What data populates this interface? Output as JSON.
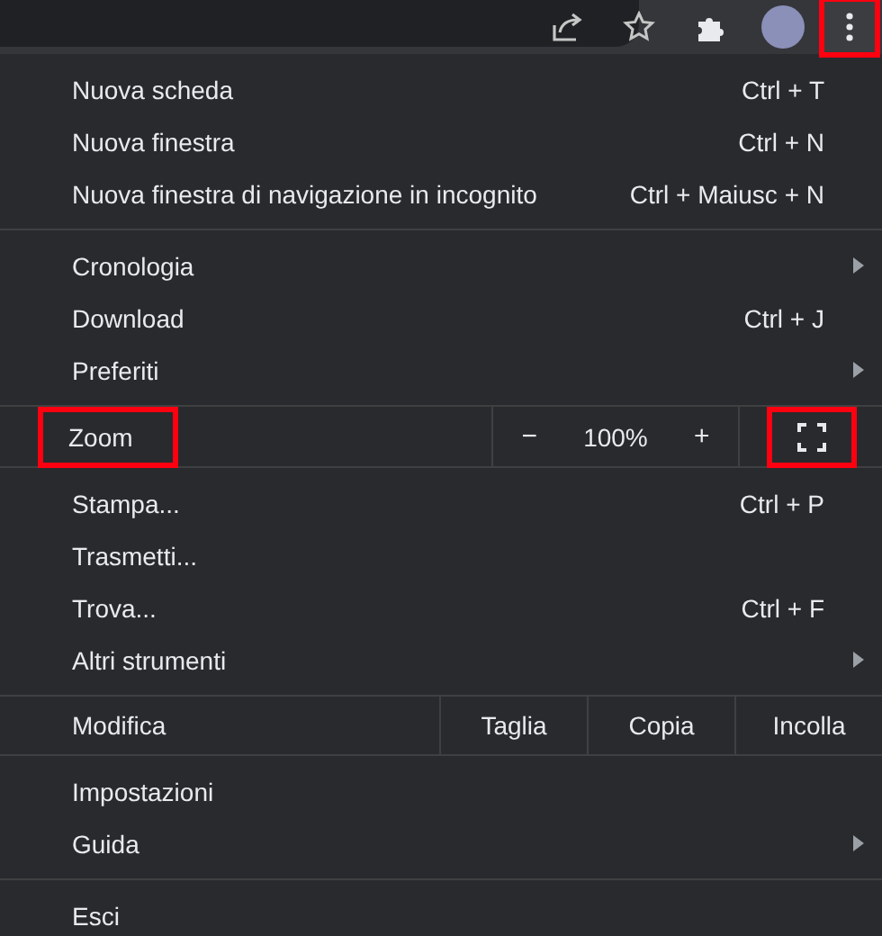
{
  "toolbar": {
    "buttons": [
      {
        "kind": "share"
      },
      {
        "kind": "star"
      },
      {
        "kind": "extensions"
      },
      {
        "kind": "avatar"
      },
      {
        "kind": "menu",
        "highlighted": true
      }
    ]
  },
  "menu": {
    "sections": [
      [
        {
          "kind": "item",
          "label": "Nuova scheda",
          "shortcut": "Ctrl + T",
          "has_submenu": false
        },
        {
          "kind": "item",
          "label": "Nuova finestra",
          "shortcut": "Ctrl + N",
          "has_submenu": false
        },
        {
          "kind": "item",
          "label": "Nuova finestra di navigazione in incognito",
          "shortcut": "Ctrl + Maiusc + N",
          "has_submenu": false
        }
      ],
      [
        {
          "kind": "item",
          "label": "Cronologia",
          "has_submenu": true
        },
        {
          "kind": "item",
          "label": "Download",
          "shortcut": "Ctrl + J",
          "has_submenu": false
        },
        {
          "kind": "item",
          "label": "Preferiti",
          "has_submenu": true
        }
      ],
      [
        {
          "kind": "zoom",
          "label": "Zoom",
          "highlighted": true,
          "minus": "−",
          "value": "100%",
          "plus": "+",
          "fullscreen_highlighted": true
        }
      ],
      [
        {
          "kind": "item",
          "label": "Stampa...",
          "shortcut": "Ctrl + P",
          "has_submenu": false
        },
        {
          "kind": "item",
          "label": "Trasmetti...",
          "has_submenu": false
        },
        {
          "kind": "item",
          "label": "Trova...",
          "shortcut": "Ctrl + F",
          "has_submenu": false
        },
        {
          "kind": "item",
          "label": "Altri strumenti",
          "has_submenu": true
        }
      ],
      [
        {
          "kind": "edit",
          "label": "Modifica",
          "actions": [
            "Taglia",
            "Copia",
            "Incolla"
          ]
        }
      ],
      [
        {
          "kind": "item",
          "label": "Impostazioni",
          "has_submenu": false
        },
        {
          "kind": "item",
          "label": "Guida",
          "has_submenu": true
        }
      ],
      [
        {
          "kind": "item",
          "label": "Esci",
          "has_submenu": false
        }
      ]
    ]
  }
}
